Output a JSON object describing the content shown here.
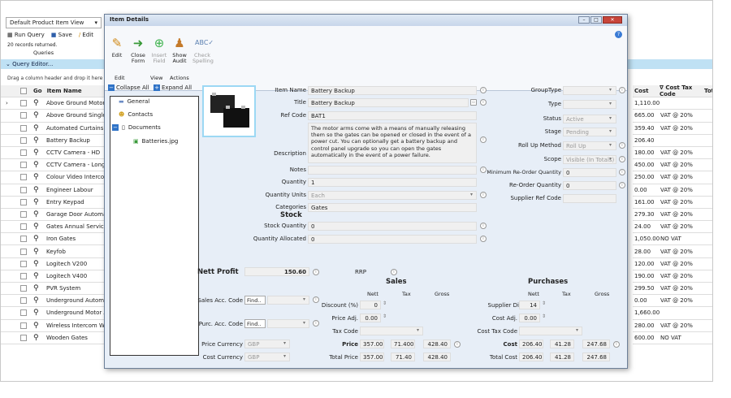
{
  "view_select": "Default Product Item View",
  "toolbar": {
    "run_query": "Run Query",
    "save": "Save",
    "edit": "Edit"
  },
  "records": "20 records returned.",
  "queries": "Queries",
  "query_editor": "Query Editor...",
  "drag_hint": "Drag a column header and drop it here to g",
  "grid_header": {
    "go": "Go",
    "item_name": "Item Name",
    "cost": "Cost",
    "cost_tax_code": "Cost Tax Code",
    "total": "Tot"
  },
  "rows": [
    {
      "name": "Above Ground Motor Au",
      "cost": "1,110.00",
      "tax": ""
    },
    {
      "name": "Above Ground Single G",
      "cost": "665.00",
      "tax": "VAT @ 20%"
    },
    {
      "name": "Automated Curtains",
      "cost": "359.40",
      "tax": "VAT @ 20%"
    },
    {
      "name": "Battery Backup",
      "cost": "206.40",
      "tax": ""
    },
    {
      "name": "CCTV Camera - HD",
      "cost": "180.00",
      "tax": "VAT @ 20%"
    },
    {
      "name": "CCTV Camera - Long R",
      "cost": "450.00",
      "tax": "VAT @ 20%"
    },
    {
      "name": "Colour Video Intercom",
      "cost": "250.00",
      "tax": "VAT @ 20%"
    },
    {
      "name": "Engineer Labour",
      "cost": "0.00",
      "tax": "VAT @ 20%"
    },
    {
      "name": "Entry Keypad",
      "cost": "161.00",
      "tax": "VAT @ 20%"
    },
    {
      "name": "Garage Door Automatic",
      "cost": "279.30",
      "tax": "VAT @ 20%"
    },
    {
      "name": "Gates Annual Service",
      "cost": "24.00",
      "tax": "VAT @ 20%"
    },
    {
      "name": "Iron Gates",
      "cost": "1,050.00",
      "tax": "NO VAT"
    },
    {
      "name": "Keyfob",
      "cost": "28.00",
      "tax": "VAT @ 20%"
    },
    {
      "name": "Logitech V200",
      "cost": "120.00",
      "tax": "VAT @ 20%"
    },
    {
      "name": "Logitech V400",
      "cost": "190.00",
      "tax": "VAT @ 20%"
    },
    {
      "name": "PVR System",
      "cost": "299.50",
      "tax": "VAT @ 20%"
    },
    {
      "name": "Underground Automatic",
      "cost": "0.00",
      "tax": "VAT @ 20%"
    },
    {
      "name": "Underground Motor Aut",
      "cost": "1,660.00",
      "tax": ""
    },
    {
      "name": "Wireless Intercom With",
      "cost": "280.00",
      "tax": "VAT @ 20%"
    },
    {
      "name": "Wooden Gates",
      "cost": "600.00",
      "tax": "NO VAT"
    }
  ],
  "dialog": {
    "title": "Item Details",
    "ribbon": {
      "edit": "Edit",
      "close_form": "Close Form",
      "insert_field": "Insert Field",
      "show_audit": "Show Audit",
      "check_spelling": "Check Spelling",
      "grp_edit": "Edit",
      "grp_view": "View",
      "grp_actions": "Actions"
    },
    "collapse_all": "Collapse All",
    "expand_all": "Expand All",
    "tree": {
      "general": "General",
      "contacts": "Contacts",
      "documents": "Documents",
      "file": "Batteries.jpg"
    },
    "labels": {
      "item_name": "Item Name",
      "title": "Title",
      "ref_code": "Ref Code",
      "description": "Description",
      "notes": "Notes",
      "quantity": "Quantity",
      "quantity_units": "Quantity Units",
      "categories": "Categories",
      "stock": "Stock",
      "stock_quantity": "Stock Quantity",
      "quantity_allocated": "Quantity Allocated",
      "group_type": "GroupType",
      "type": "Type",
      "status": "Status",
      "stage": "Stage",
      "roll_up_method": "Roll Up Method",
      "scope": "Scope",
      "min_reorder": "Minimum Re-Order Quantity",
      "reorder": "Re-Order Quantity",
      "supplier_ref": "Supplier Ref Code"
    },
    "values": {
      "item_name": "Battery Backup",
      "title": "Battery Backup",
      "ref_code": "BAT1",
      "description": "The motor arms come with a means of manually releasing them so the gates can be opened or closed in the event of a power cut. You can optionally get a battery backup and control panel upgrade so you can open the gates automatically in the event of a power failure.",
      "quantity": "1",
      "quantity_units": "Each",
      "categories": "Gates",
      "stock_quantity": "0",
      "quantity_allocated": "0",
      "status": "Active",
      "stage": "Pending",
      "roll_up_method": "Roll Up",
      "scope": "Visible (In Totals)",
      "min_reorder": "0",
      "reorder": "0"
    },
    "nett_profit": "Nett Profit",
    "nett_profit_value": "150.60",
    "rrp": "RRP",
    "sales": "Sales",
    "purchases": "Purchases",
    "nett": "Nett",
    "tax": "Tax",
    "gross": "Gross",
    "sales_acc": "Sales Acc. Code",
    "purc_acc": "Purc. Acc. Code",
    "find": "Find..",
    "price_currency": "Price Currency",
    "cost_currency": "Cost Currency",
    "gbp": "GBP",
    "discount": "Discount (%)",
    "discount_v": "0",
    "price_adj": "Price Adj.",
    "price_adj_v": "0.00",
    "tax_code": "Tax Code",
    "price": "Price",
    "price_n": "357.00",
    "price_t": "71.400",
    "price_g": "428.40",
    "total_price": "Total Price",
    "tp_n": "357.00",
    "tp_t": "71.40",
    "tp_g": "428.40",
    "supplier_disc": "Supplier Disc. (%)",
    "supplier_disc_v": "14",
    "cost_adj": "Cost Adj.",
    "cost_adj_v": "0.00",
    "cost_tax_code": "Cost Tax Code",
    "cost": "Cost",
    "cost_n": "206.40",
    "cost_t": "41.28",
    "cost_g": "247.68",
    "total_cost": "Total Cost",
    "tc_n": "206.40",
    "tc_t": "41.28",
    "tc_g": "247.68"
  }
}
